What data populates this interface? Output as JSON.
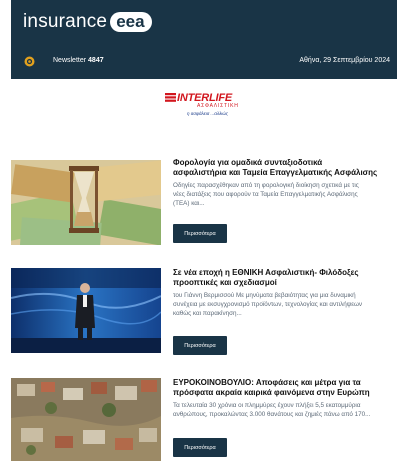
{
  "header": {
    "logo_word": "insurance",
    "logo_pill": "eea",
    "newsletter_label": "Newsletter",
    "newsletter_number": "4847",
    "date": "Αθήνα, 29 Σεπτεμβρίου 2024"
  },
  "sponsor": {
    "brand": "INTERLIFE",
    "subtitle": "ΑΣΦΑΛΙΣΤΙΚΗ",
    "tagline": "η ασφάλεια ...αλλιώς"
  },
  "articles": [
    {
      "title_line1": "Φορολογία για ομαδικά συνταξιοδοτικά",
      "title_line2": "ασφαλιστήρια και Ταμεία Επαγγελματικής Ασφάλισης",
      "excerpt_line1": "Οδηγίες παρασχέθηκαν από τη φορολογική διοίκηση σχετικά με τις",
      "excerpt_line2": "νέες διατάξεις που αφορούν τα Ταμεία Επαγγελματικής Ασφάλισης",
      "excerpt_line3": "(ΤΕΑ) και...",
      "button": "Περισσότερα"
    },
    {
      "title_line1": "Σε νέα εποχή η ΕΘΝΙΚΗ Ασφαλιστική- Φιλόδοξες",
      "title_line2": "προοπτικές και σχεδιασμοί",
      "excerpt_line1": "του Γιάννη Βερμισσού Με μηνύματα βεβαιότητας για μια δυναμική",
      "excerpt_line2": "συνέχεια με εκσυγχρονισμό προϊόντων, τεχνολογίας και αντιλήψεων",
      "excerpt_line3": "καθώς και παρακίνηση...",
      "button": "Περισσότερα"
    },
    {
      "title_line1": "ΕΥΡΟΚΟΙΝΟΒΟΥΛΙΟ: Αποφάσεις και μέτρα για τα",
      "title_line2": "πρόσφατα ακραία καιρικά φαινόμενα στην Ευρώπη",
      "excerpt_line1": "Τα τελευταία 30 χρόνια οι πλημμύρες έχουν πλήξει 5,5 εκατομμύρια",
      "excerpt_line2": "ανθρώπους, προκαλώντας 3.000 θανάτους και ζημιές πάνω από 170...",
      "button": "Περισσότερα"
    }
  ],
  "colors": {
    "header_bg": "#193446",
    "button_bg": "#193446",
    "sponsor_red": "#d2161e",
    "excerpt_text": "#5d6a78"
  }
}
